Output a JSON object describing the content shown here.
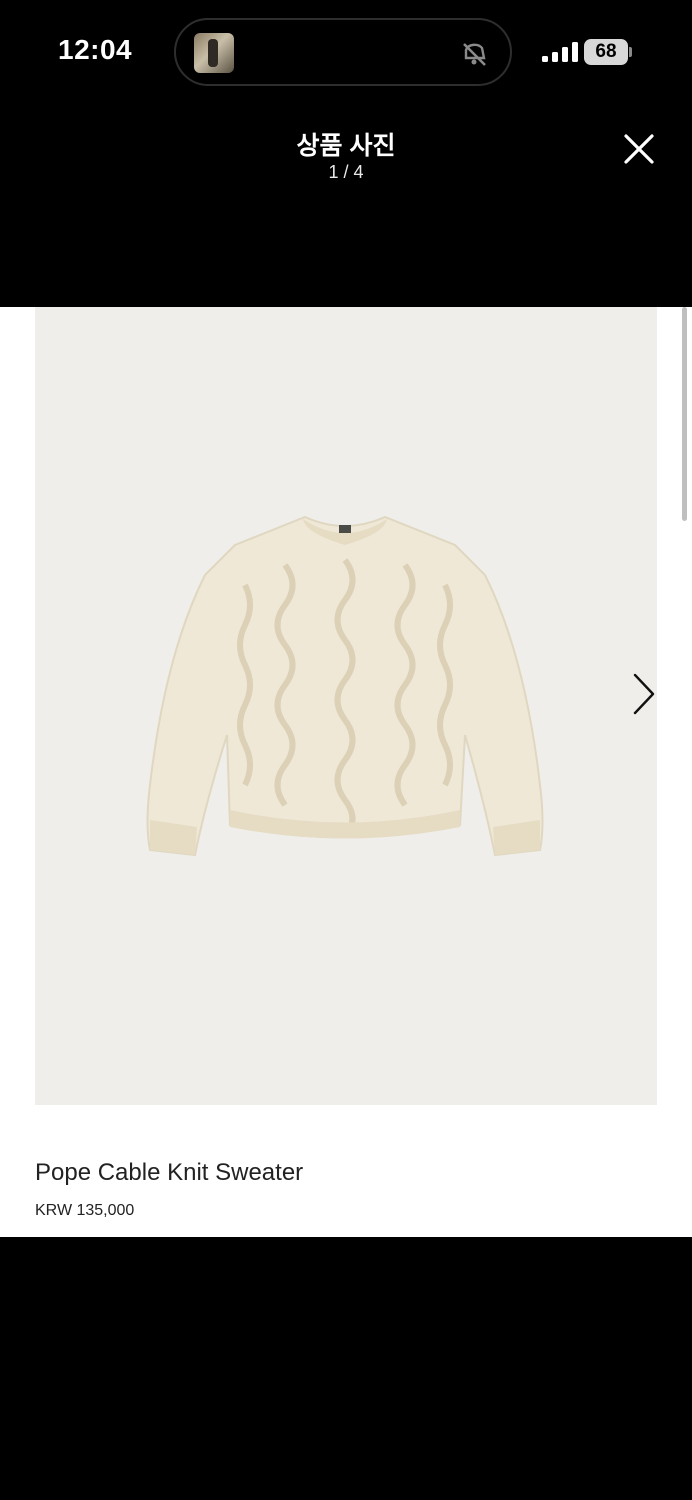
{
  "status_bar": {
    "time": "12:04",
    "battery": "68",
    "island_icons": [
      "photo-thumbnail-icon",
      "muted-icon"
    ]
  },
  "header": {
    "title": "상품 사진",
    "counter": "1 / 4",
    "close_icon": "close-icon"
  },
  "product": {
    "name": "Pope Cable Knit Sweater",
    "price": "KRW 135,000",
    "image_bg": "#efeeeb",
    "sweater_color": "#efe8d6"
  },
  "gallery": {
    "next_icon": "chevron-right-icon"
  }
}
